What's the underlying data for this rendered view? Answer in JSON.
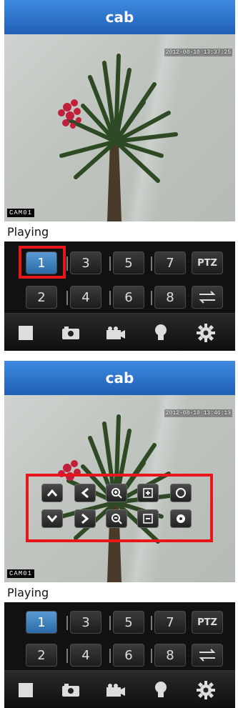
{
  "screens": [
    {
      "title": "cab",
      "timestamp": "2012-08-10 13:37:25",
      "camera_label": "CAM01",
      "status": "Playing",
      "grid_buttons": [
        "1",
        "3",
        "5",
        "7",
        "PTZ",
        "2",
        "4",
        "6",
        "8"
      ],
      "selected": "1"
    },
    {
      "title": "cab",
      "timestamp": "2012-08-10 13:46:13",
      "camera_label": "CAM01",
      "status": "Playing",
      "grid_buttons": [
        "1",
        "3",
        "5",
        "7",
        "PTZ",
        "2",
        "4",
        "6",
        "8"
      ],
      "selected": "1",
      "ptz_controls": [
        "up-icon",
        "left-icon",
        "zoom-in-icon",
        "focus-in-icon",
        "iris-open-icon",
        "down-icon",
        "right-icon",
        "zoom-out-icon",
        "focus-out-icon",
        "iris-close-icon"
      ]
    }
  ],
  "toolbar_icons": [
    "stop-icon",
    "snapshot-icon",
    "record-icon",
    "light-icon",
    "settings-icon"
  ],
  "colors": {
    "title_bar": "#2d74d0",
    "highlight": "#e8151b",
    "selected_button": "#3f83c4",
    "background": "#0b0b0b"
  }
}
